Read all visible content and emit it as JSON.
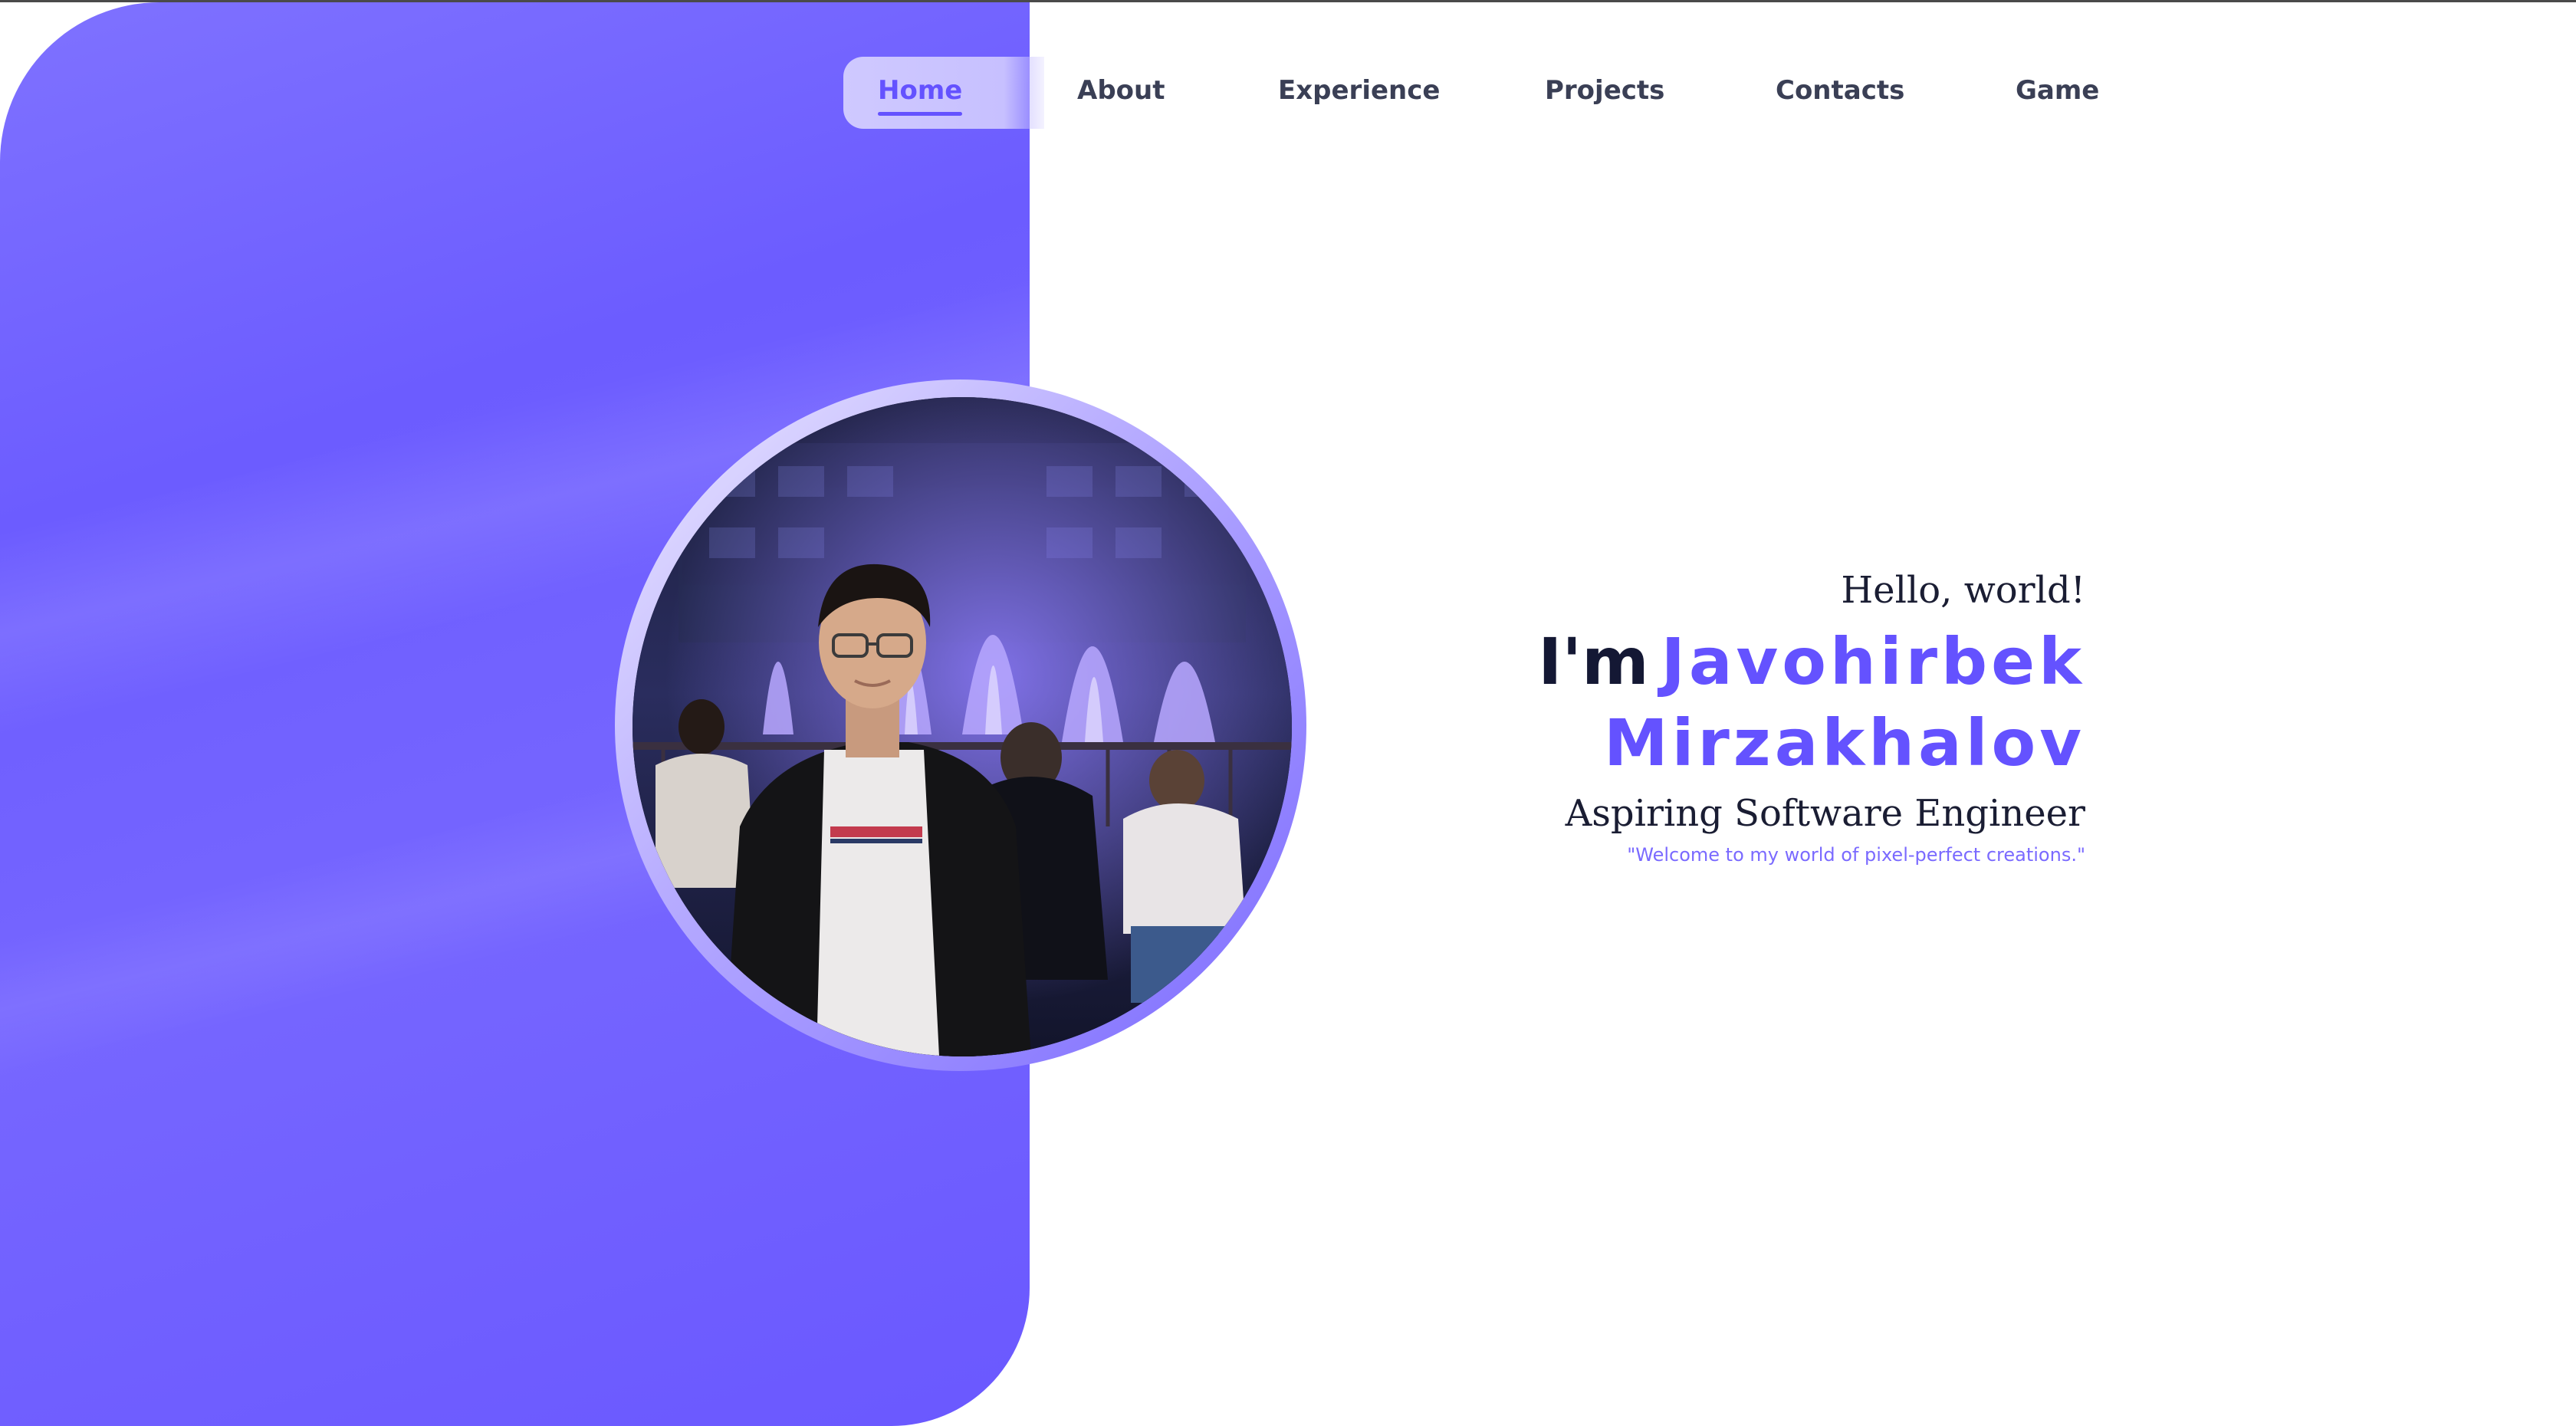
{
  "nav": {
    "items": [
      {
        "label": "Home",
        "active": true
      },
      {
        "label": "About",
        "active": false
      },
      {
        "label": "Experience",
        "active": false
      },
      {
        "label": "Projects",
        "active": false
      },
      {
        "label": "Contacts",
        "active": false
      },
      {
        "label": "Game",
        "active": false
      }
    ]
  },
  "hero": {
    "greeting": "Hello, world!",
    "intro": "I'm",
    "first_name": "Javohirbek",
    "last_name": "Mirzakhalov",
    "role": "Aspiring Software Engineer",
    "tagline": "\"Welcome to my world of pixel-perfect creations.\""
  },
  "colors": {
    "accent": "#6452ff",
    "panel": "#7063ff",
    "text_dark": "#141834"
  }
}
